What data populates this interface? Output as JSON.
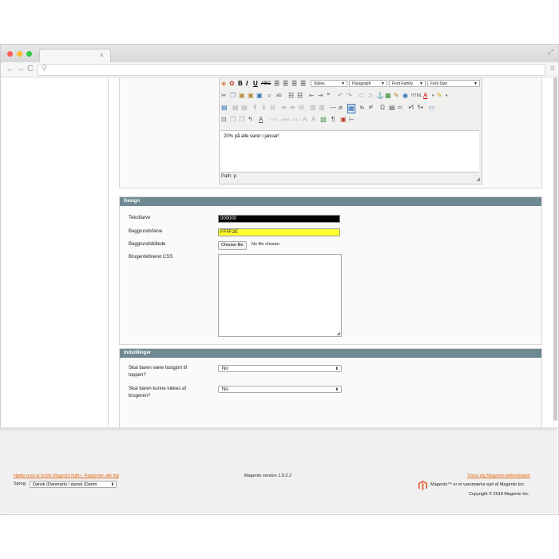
{
  "browser": {
    "tab_close": "×",
    "expand": "⤢",
    "nav_back": "←",
    "nav_forward": "→",
    "nav_reload": "C",
    "search_glyph": "⚲",
    "menu_glyph": "≡",
    "colors": {
      "close": "#fc5f57",
      "minimize": "#fdbc2e",
      "maximize": "#33c748"
    }
  },
  "editor": {
    "styles_select": "Styles",
    "paragraph_select": "Paragraph",
    "font_family_select": "Font Family",
    "font_size_select": "Font Size",
    "content": "20% på alle varer i januar!",
    "path": "Path: p",
    "toolbar_icons": [
      "source-icon",
      "spellcheck-icon",
      "bold-icon",
      "italic-icon",
      "underline-icon",
      "strikethrough-icon",
      "align-left-icon",
      "align-center-icon",
      "align-right-icon",
      "justify-icon",
      "cut-icon",
      "copy-icon",
      "paste-icon",
      "paste-text-icon",
      "paste-word-icon",
      "find-icon",
      "replace-icon",
      "bullet-list-icon",
      "numbered-list-icon",
      "outdent-icon",
      "indent-icon",
      "blockquote-icon",
      "undo-icon",
      "redo-icon",
      "link-icon",
      "unlink-icon",
      "anchor-icon",
      "image-icon",
      "cleanup-icon",
      "help-icon",
      "html-icon",
      "text-color-icon",
      "background-color-icon"
    ]
  },
  "design": {
    "header": "Design",
    "text_color_label": "Tekstfarve",
    "text_color_value": "000000",
    "text_color_bg": "#000000",
    "bg_color_label": "Baggrundsfarve",
    "bg_color_value": "FFFF2E",
    "bg_color_bg": "#FFFF2E",
    "bg_image_label": "Baggrundsbillede",
    "choose_file": "Choose file",
    "no_file": "No file chosen",
    "custom_css_label": "Brugerdefineret CSS"
  },
  "settings": {
    "header": "Indstillinger",
    "fixed_label_line1": "Skal baren være fastgjort til",
    "fixed_label_line2": "toppen?",
    "fixed_value": "No",
    "closable_label_line1": "Skal baren kunne lukkes af",
    "closable_label_line2": "brugeren?",
    "closable_value": "No"
  },
  "footer": {
    "help_link": "Hjælp med at holde Magento fejlfri - Rapporter alle fejl",
    "language_label": "Sprog:",
    "language_value": "Dansk (Danmark) / dansk (Danm",
    "version": "Magento version 1.9.2.2",
    "community_link": "Tilslut dig Magento-fællesskabet",
    "trademark": "Magento™ er et varemærke ejet af Magento Inc.",
    "copyright": "Copyright © 2018 Magento Inc.",
    "accent_color": "#e26a16",
    "logo_color": "#e0501e"
  }
}
